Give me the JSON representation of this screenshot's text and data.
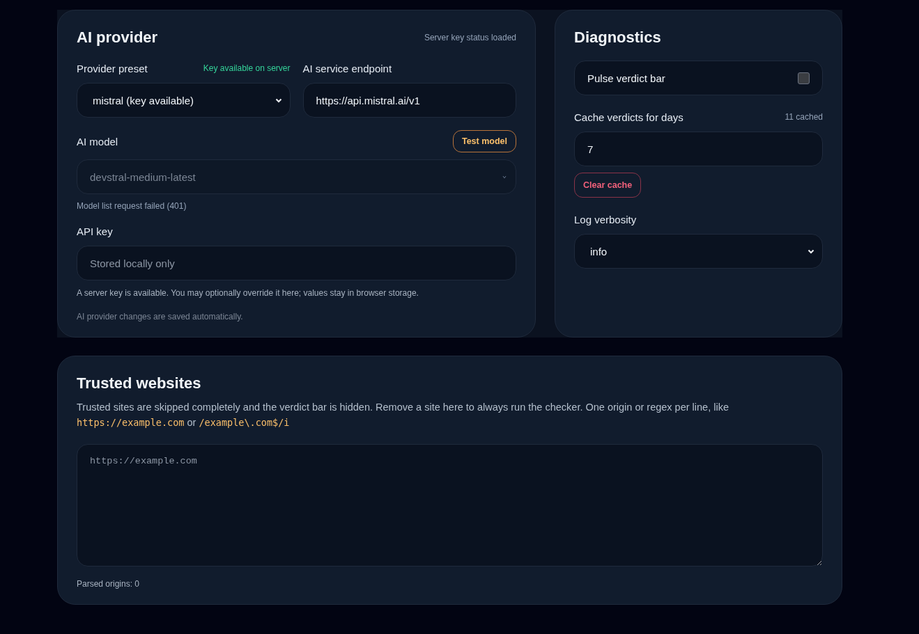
{
  "ai_provider": {
    "title": "AI provider",
    "status": "Server key status loaded",
    "preset": {
      "label": "Provider preset",
      "hint": "Key available on server",
      "value": "mistral (key available)"
    },
    "endpoint": {
      "label": "AI service endpoint",
      "value": "https://api.mistral.ai/v1"
    },
    "model": {
      "label": "AI model",
      "button": "Test model",
      "value": "devstral-medium-latest",
      "disabled": true,
      "error": "Model list request failed (401)"
    },
    "api_key": {
      "label": "API key",
      "placeholder": "Stored locally only",
      "help": "A server key is available. You may optionally override it here; values stay in browser storage."
    },
    "footer": "AI provider changes are saved automatically."
  },
  "diagnostics": {
    "title": "Diagnostics",
    "pulse": {
      "label": "Pulse verdict bar",
      "checked": false
    },
    "cache": {
      "label": "Cache verdicts for days",
      "count": "11 cached",
      "value": "7",
      "button": "Clear cache"
    },
    "log": {
      "label": "Log verbosity",
      "value": "info"
    }
  },
  "trusted": {
    "title": "Trusted websites",
    "description": "Trusted sites are skipped completely and the verdict bar is hidden. Remove a site here to always run the checker. One origin or regex per line, like",
    "examples": [
      "https://example.com",
      "/example\\.com$/i"
    ],
    "joiner": "or",
    "placeholder": "https://example.com",
    "parsed": "Parsed origins: 0"
  }
}
